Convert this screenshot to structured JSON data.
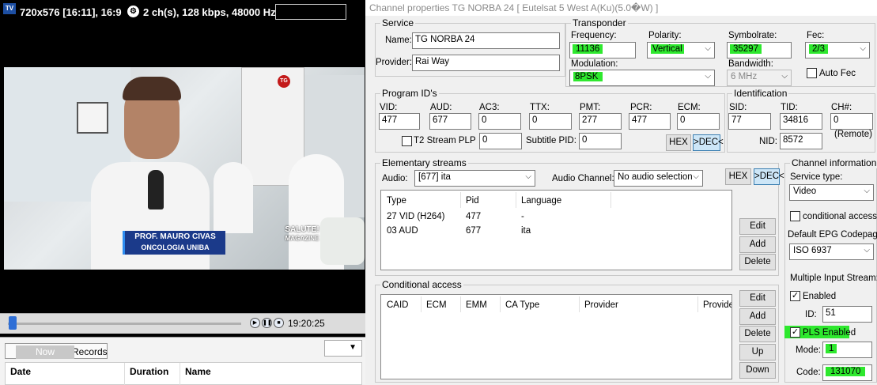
{
  "player": {
    "tv_label": "TV",
    "video_info": "720x576 [16:11], 16:9",
    "audio_info": "2 ch(s), 128 kbps, 48000 Hz",
    "overlay_tg": "TG",
    "caption_name": "PROF. MAURO CIVAS",
    "caption_role": "ONCOLOGIA UNIBA",
    "brand_line1": "SALUTE!",
    "brand_line2": "MAGAZINE",
    "time": "19:20:25",
    "tab_now": "Now",
    "tab_records": "Records",
    "columns": [
      "Date",
      "Duration",
      "Name"
    ]
  },
  "dialog": {
    "title": "Channel properties TG NORBA 24 [ Eutelsat 5 West A(Ku)(5.0�W) ]",
    "service": {
      "caption": "Service",
      "name_label": "Name:",
      "name": "TG NORBA 24",
      "provider_label": "Provider:",
      "provider": "Rai Way"
    },
    "transponder": {
      "caption": "Transponder",
      "frequency_label": "Frequency:",
      "frequency": "11136",
      "polarity_label": "Polarity:",
      "polarity": "Vertical",
      "symbolrate_label": "Symbolrate:",
      "symbolrate": "35297",
      "fec_label": "Fec:",
      "fec": "2/3",
      "modulation_label": "Modulation:",
      "modulation": "8PSK",
      "bandwidth_label": "Bandwidth:",
      "bandwidth": "6 MHz",
      "autofec_label": "Auto Fec"
    },
    "program_ids": {
      "caption": "Program ID's",
      "vid_label": "VID:",
      "vid": "477",
      "aud_label": "AUD:",
      "aud": "677",
      "ac3_label": "AC3:",
      "ac3": "0",
      "ttx_label": "TTX:",
      "ttx": "0",
      "pmt_label": "PMT:",
      "pmt": "277",
      "pcr_label": "PCR:",
      "pcr": "477",
      "ecm_label": "ECM:",
      "ecm": "0",
      "t2_label": "T2 Stream PLP",
      "t2": "0",
      "subtitle_label": "Subtitle PID:",
      "subtitle": "0",
      "hex": "HEX",
      "dec": ">DEC<"
    },
    "identification": {
      "caption": "Identification",
      "sid_label": "SID:",
      "sid": "77",
      "tid_label": "TID:",
      "tid": "34816",
      "ch_label": "CH#:",
      "ch": "0",
      "remote": "(Remote)",
      "nid_label": "NID:",
      "nid": "8572"
    },
    "elementary": {
      "caption": "Elementary streams",
      "audio_label": "Audio:",
      "audio": "[677] ita",
      "channel_label": "Audio Channel:",
      "channel": "No audio selection",
      "hex": "HEX",
      "dec": ">DEC<",
      "columns": [
        "Type",
        "Pid",
        "Language"
      ],
      "rows": [
        {
          "type": "27 VID (H264)",
          "pid": "477",
          "lang": "-"
        },
        {
          "type": "03 AUD",
          "pid": "677",
          "lang": "ita"
        }
      ],
      "edit": "Edit",
      "add": "Add",
      "delete": "Delete"
    },
    "conditional": {
      "caption": "Conditional access",
      "columns": [
        "CAID",
        "ECM",
        "EMM",
        "CA Type",
        "Provider",
        "Provider"
      ],
      "edit": "Edit",
      "add": "Add",
      "delete": "Delete",
      "up": "Up",
      "down": "Down"
    },
    "channel_info": {
      "caption": "Channel information",
      "service_type_label": "Service type:",
      "service_type": "Video",
      "conditional_label": "conditional access",
      "epg_label": "Default EPG Codepage:",
      "epg": "ISO 6937",
      "mis_label": "Multiple Input Stream:",
      "enabled_label": "Enabled",
      "id_label": "ID:",
      "id": "51",
      "pls_label": "PLS Enabled",
      "mode_label": "Mode:",
      "mode": "1",
      "code_label": "Code:",
      "code": "131070"
    },
    "highlight_color": "#2ee82e"
  }
}
